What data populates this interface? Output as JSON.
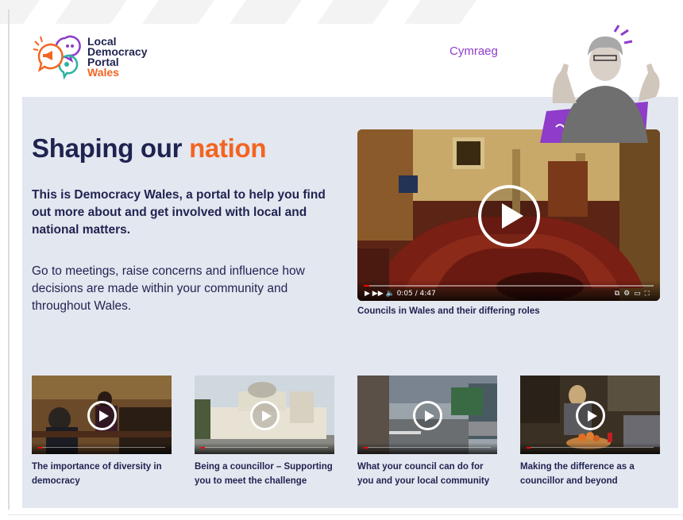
{
  "header": {
    "logo": {
      "line1": "Local",
      "line2": "Democracy",
      "line3": "Portal",
      "line4": "Wales"
    },
    "language_link": "Cymraeg"
  },
  "hero": {
    "title_main": "Shaping our",
    "title_accent": "nation",
    "intro": "This is Democracy Wales, a portal to help you find out more about and get involved with local and national matters.",
    "body": "Go to meetings, raise concerns and influence how decisions are made within your community and throughout Wales."
  },
  "featured_video": {
    "caption": "Councils in Wales and their differing roles",
    "channel_label": "Play (k)",
    "time": "0:05 / 4:47"
  },
  "videos": [
    {
      "caption": "The importance of diversity in democracy"
    },
    {
      "caption": "Being a councillor – Supporting you to meet the challenge"
    },
    {
      "caption": "What your council can do for you and your local community"
    },
    {
      "caption": "Making the difference as a councillor and beyond"
    }
  ],
  "colors": {
    "navy": "#1f2350",
    "orange": "#f26522",
    "purple": "#8e3cc9",
    "panel": "#e3e7f0"
  }
}
